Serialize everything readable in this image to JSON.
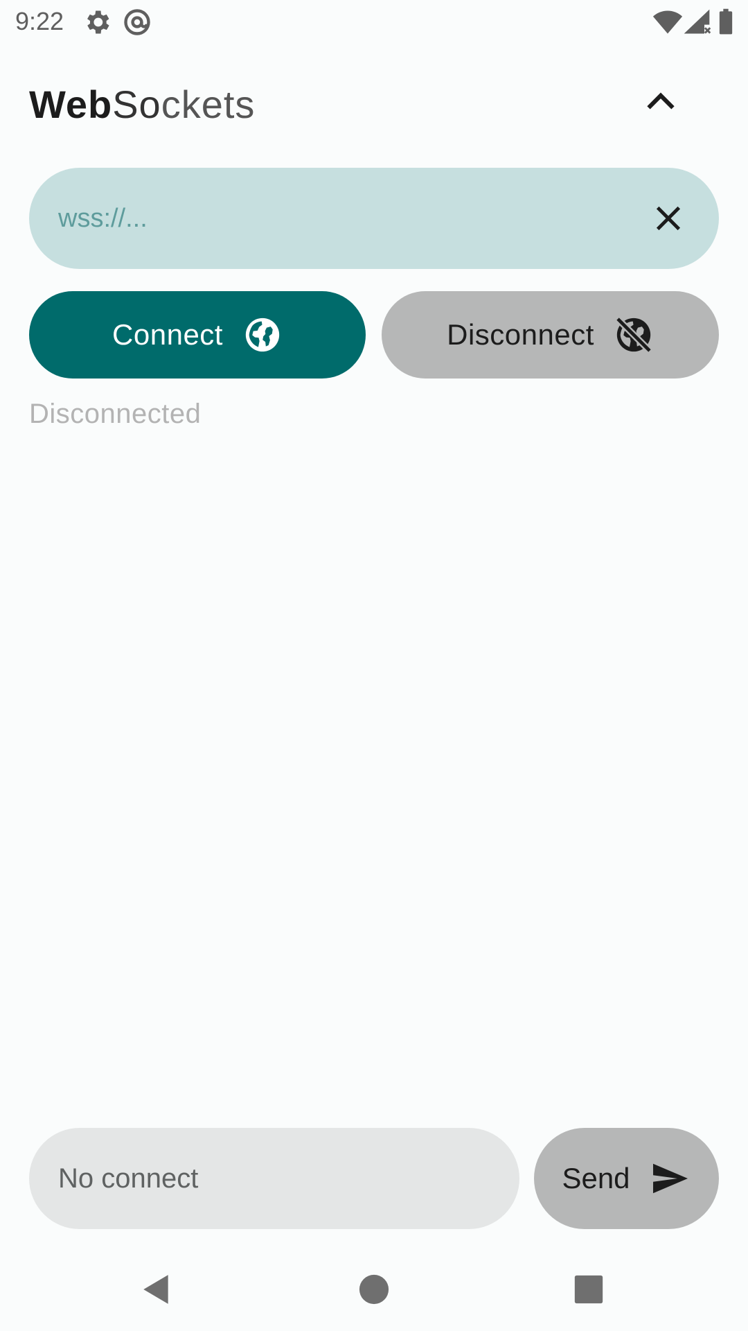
{
  "status_bar": {
    "time": "9:22",
    "icons": [
      "settings-icon",
      "at-sign-icon",
      "wifi-icon",
      "cell-signal-icon",
      "battery-icon"
    ]
  },
  "header": {
    "title_part1": "Web",
    "title_part2": "So",
    "title_part3": "ckets",
    "collapse_icon": "chevron-up-icon"
  },
  "url_field": {
    "value": "",
    "placeholder": "wss://...",
    "clear_icon": "close-icon"
  },
  "actions": {
    "connect_label": "Connect",
    "connect_icon": "globe-icon",
    "disconnect_label": "Disconnect",
    "disconnect_icon": "globe-off-icon"
  },
  "connection_status": "Disconnected",
  "composer": {
    "value": "",
    "placeholder": "No connect",
    "send_label": "Send",
    "send_icon": "send-icon"
  },
  "navigation": {
    "icons": [
      "back-icon",
      "home-icon",
      "recents-icon"
    ]
  },
  "colors": {
    "primary": "#006b6b",
    "url_field_bg": "#c6dfdf",
    "disabled_button": "#b6b7b7",
    "message_field_bg": "#e4e6e6",
    "status_text": "#b3b3b3",
    "background": "#fafcfc"
  }
}
